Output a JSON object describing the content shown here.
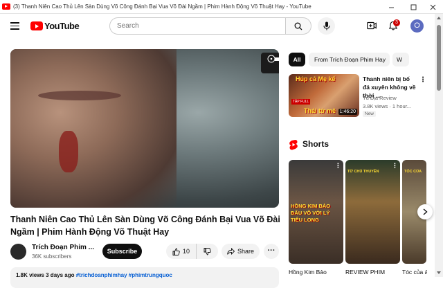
{
  "window": {
    "title": "(3) Thanh Niên Cao Thủ Lên Sàn Dùng Võ Công Đánh Bại Vua Võ Đài Ngầm | Phim Hành Động Võ Thuật Hay - YouTube"
  },
  "masthead": {
    "logo_text": "YouTube",
    "search_placeholder": "Search",
    "notification_count": "3",
    "avatar_letter": "O"
  },
  "video": {
    "title": "Thanh Niên Cao Thủ Lên Sàn Dùng Võ Công Đánh Bại Vua Võ Đài Ngầm | Phim Hành Động Võ Thuật Hay",
    "channel_name": "Trích Đoạn Phim ...",
    "subscribers": "36K subscribers",
    "subscribe_label": "Subscribe",
    "likes": "10",
    "share_label": "Share",
    "description_meta": "1.8K views  3 days ago",
    "description_tags": "#trichdoanphimhay #phimtrungquoc"
  },
  "chips": [
    "All",
    "From Trích Đoạn Phim Hay",
    "W"
  ],
  "recommendation": {
    "thumb_text_top": "Húp cả Mẹ kế",
    "thumb_text_bottom": "Thái tử mê",
    "thumb_tag": "TẬP FULL",
    "duration": "1:46:20",
    "title": "Thanh niên bị bố đá xuyên không về thời ...",
    "channel": "Tú Địa Review",
    "stats": "3.8K views · 1 hour...",
    "badge": "New"
  },
  "shorts": {
    "heading": "Shorts",
    "items": [
      {
        "title": "Hồng Kim Bảo",
        "caption": "HỒNG KIM BẢO ĐẤU VÕ VỚI LÝ TIỂU LONG",
        "header": ""
      },
      {
        "title": "REVIEW PHIM",
        "caption": "",
        "header": "TỪ CHỦ THUYỀN"
      },
      {
        "title": "Tóc của ả",
        "caption": "",
        "header": "TÓC CỦA"
      }
    ]
  }
}
